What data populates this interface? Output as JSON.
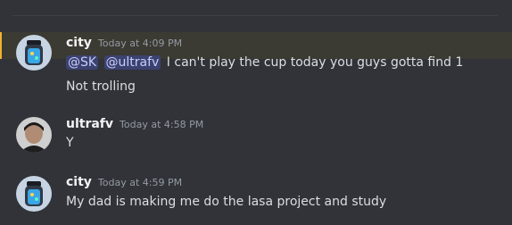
{
  "messages": [
    {
      "username": "city",
      "timestamp": "Today at 4:09 PM",
      "mentions": [
        "@SK",
        "@ultrafv"
      ],
      "text": "I can't play the cup today you guys gotta find 1",
      "followup": "Not trolling",
      "highlighted": true
    },
    {
      "username": "ultrafv",
      "timestamp": "Today at 4:58 PM",
      "text": "Y"
    },
    {
      "username": "city",
      "timestamp": "Today at 4:59 PM",
      "text": "My dad is making me do the lasa project and study"
    }
  ],
  "colors": {
    "background": "#313338",
    "mention_highlight_bar": "#f0b232",
    "mention_pill": "#3c4270"
  },
  "avatars": [
    "city-avatar-image",
    "ultrafv-avatar-photo",
    "city-avatar-image"
  ]
}
